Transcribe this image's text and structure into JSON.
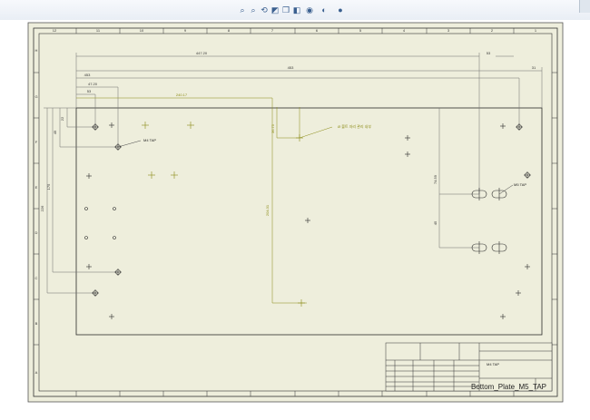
{
  "toolbar": {
    "icons": [
      "zoom-fit-icon",
      "zoom-area-icon",
      "previous-view-icon",
      "section-view-icon",
      "view-orientation-icon",
      "display-style-icon",
      "hide-show-icon",
      "appearance-icon",
      "scene-icon"
    ]
  },
  "drawing": {
    "zone_numbers_top": [
      "12",
      "11",
      "10",
      "9",
      "8",
      "7",
      "6",
      "5",
      "4",
      "3",
      "2",
      "1"
    ],
    "zone_letters_left": [
      "H",
      "G",
      "F",
      "E",
      "D",
      "C",
      "B",
      "A"
    ],
    "dimensions": {
      "d1": "447.20",
      "d2": "453",
      "d3": "453",
      "d4": "47.20",
      "d5": "53",
      "d6": "53",
      "d7": "240.17",
      "d8": "22",
      "d9": "49",
      "d10": "175",
      "d11": "226",
      "d12": "36.75",
      "d13": "204.31",
      "d14": "74.59",
      "d15": "45",
      "d16": "53",
      "d17": "31"
    },
    "callouts": {
      "m4_tap_left": "M4 TAP",
      "m4_tap_right": "M5 TAP",
      "counterbore_note": "Ø 볼트 자리 관리 내부"
    },
    "title_block": {
      "m4_note": "M4 TAP",
      "drawing_name": "Bottom_Plate_M5_TAP"
    },
    "colors": {
      "sheet_bg": "#eeeedc",
      "line": "#2a2a2a",
      "dim_line": "#6f6f6f",
      "yellow_dim": "#8a8a14",
      "accent_blue": "#3a5f8f"
    }
  }
}
